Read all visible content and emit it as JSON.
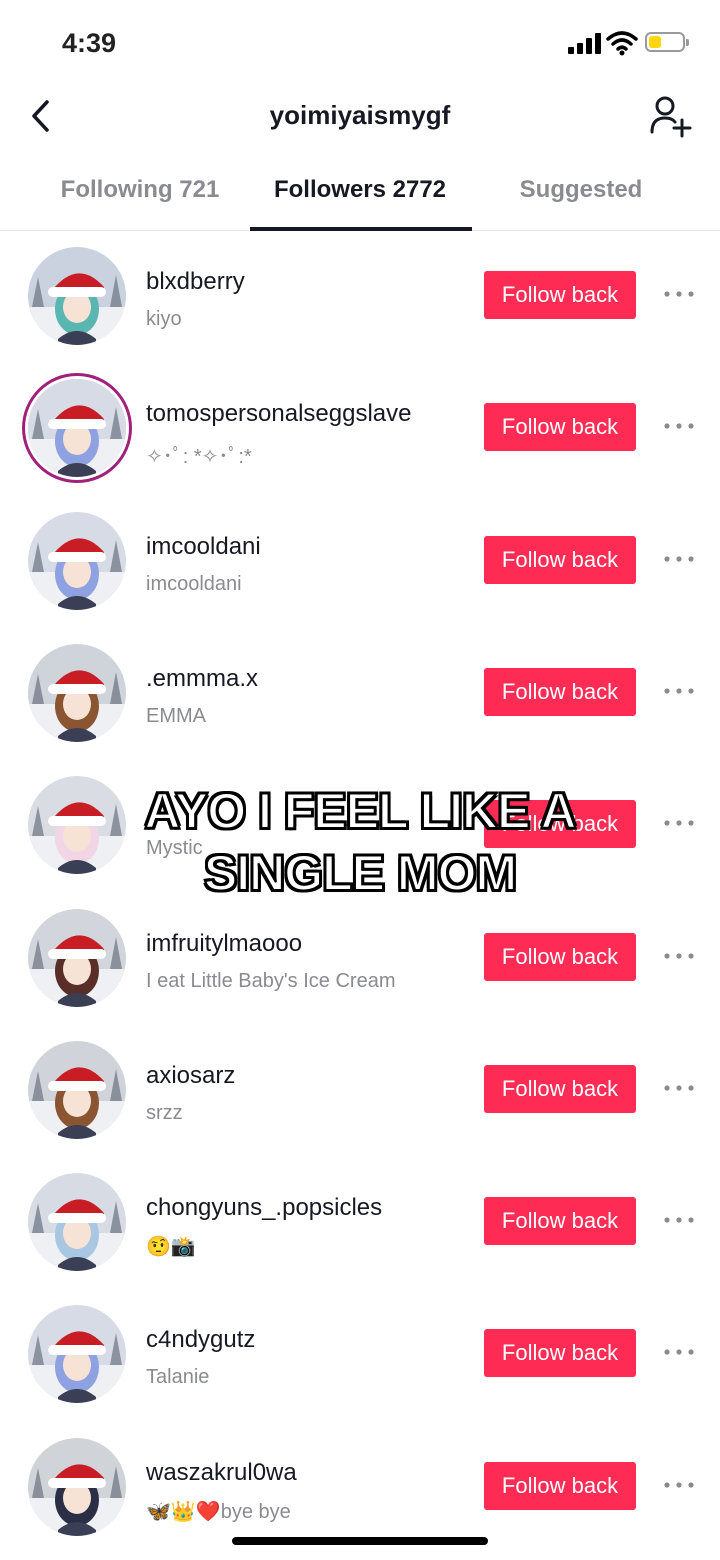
{
  "status_bar": {
    "time": "4:39"
  },
  "header": {
    "title": "yoimiyaismygf"
  },
  "tabs": [
    {
      "label": "Following 721",
      "active": false
    },
    {
      "label": "Followers 2772",
      "active": true
    },
    {
      "label": "Suggested",
      "active": false
    }
  ],
  "followers": [
    {
      "username": "blxdberry",
      "subname": "kiyo",
      "button": "Follow back",
      "avatar_colors": [
        "#c9d2de",
        "#5ab6b0"
      ]
    },
    {
      "username": "tomospersonalseggslave",
      "subname": "✧･ﾟ: *✧･ﾟ:*",
      "button": "Follow back",
      "avatar_colors": [
        "#d7dbe6",
        "#8ea1e0"
      ]
    },
    {
      "username": "imcooldani",
      "subname": "imcooldani",
      "button": "Follow back",
      "avatar_colors": [
        "#d7dbe6",
        "#8ea1e0"
      ]
    },
    {
      "username": ".emmma.x",
      "subname": "EMMA",
      "button": "Follow back",
      "avatar_colors": [
        "#cfd3da",
        "#8a5530"
      ]
    },
    {
      "username": "",
      "subname": "Mystic",
      "button": "Follow back",
      "avatar_colors": [
        "#d9dde3",
        "#f3d6e6"
      ]
    },
    {
      "username": "imfruitylmaooo",
      "subname": "I eat Little Baby's Ice Cream",
      "button": "Follow back",
      "avatar_colors": [
        "#d2d5db",
        "#5a2e28"
      ]
    },
    {
      "username": "axiosarz",
      "subname": "srzz",
      "button": "Follow back",
      "avatar_colors": [
        "#d0d4da",
        "#8a5530"
      ]
    },
    {
      "username": "chongyuns_.popsicles",
      "subname": "🤨📸",
      "button": "Follow back",
      "avatar_colors": [
        "#d7dbe3",
        "#a9c6e3"
      ]
    },
    {
      "username": "c4ndygutz",
      "subname": "Talanie",
      "button": "Follow back",
      "avatar_colors": [
        "#d7dbe6",
        "#8ea1e0"
      ]
    },
    {
      "username": "waszakrul0wa",
      "subname": "🦋👑❤️bye bye",
      "button": "Follow back",
      "avatar_colors": [
        "#d0d3d8",
        "#2a2f45"
      ]
    }
  ],
  "caption": {
    "line1": "AYO I FEEL LIKE A",
    "line2": "SINGLE MOM"
  },
  "colors": {
    "accent": "#fe2c55",
    "santa_hat": "#c81d25"
  },
  "icons": [
    "back-icon",
    "add-user-icon",
    "more-icon",
    "signal-icon",
    "wifi-icon",
    "battery-icon"
  ]
}
